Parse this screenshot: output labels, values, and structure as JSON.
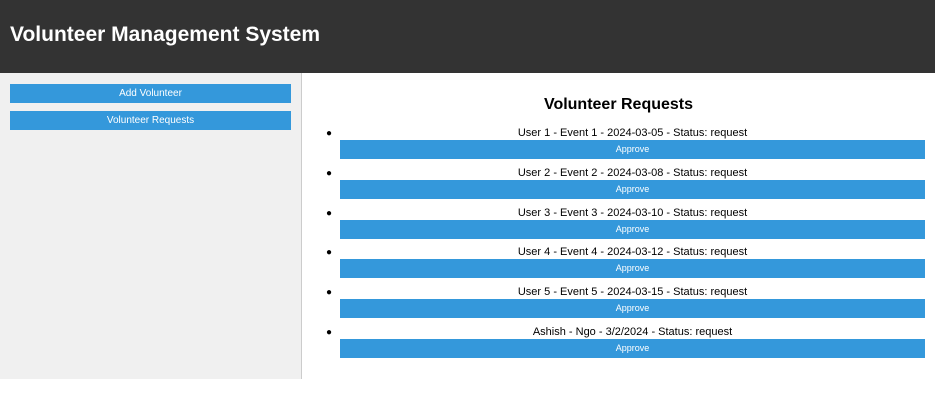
{
  "header": {
    "title": "Volunteer Management System"
  },
  "sidebar": {
    "add_volunteer_label": "Add Volunteer",
    "volunteer_requests_label": "Volunteer Requests"
  },
  "main": {
    "title": "Volunteer Requests",
    "requests": [
      {
        "text": "User 1 - Event 1 - 2024-03-05 - Status: request",
        "button": "Approve"
      },
      {
        "text": "User 2 - Event 2 - 2024-03-08 - Status: request",
        "button": "Approve"
      },
      {
        "text": "User 3 - Event 3 - 2024-03-10 - Status: request",
        "button": "Approve"
      },
      {
        "text": "User 4 - Event 4 - 2024-03-12 - Status: request",
        "button": "Approve"
      },
      {
        "text": "User 5 - Event 5 - 2024-03-15 - Status: request",
        "button": "Approve"
      },
      {
        "text": "Ashish - Ngo - 3/2/2024 - Status: request",
        "button": "Approve"
      }
    ]
  },
  "colors": {
    "header_bg": "#333333",
    "sidebar_bg": "#f0f0f0",
    "button_bg": "#3498db"
  }
}
